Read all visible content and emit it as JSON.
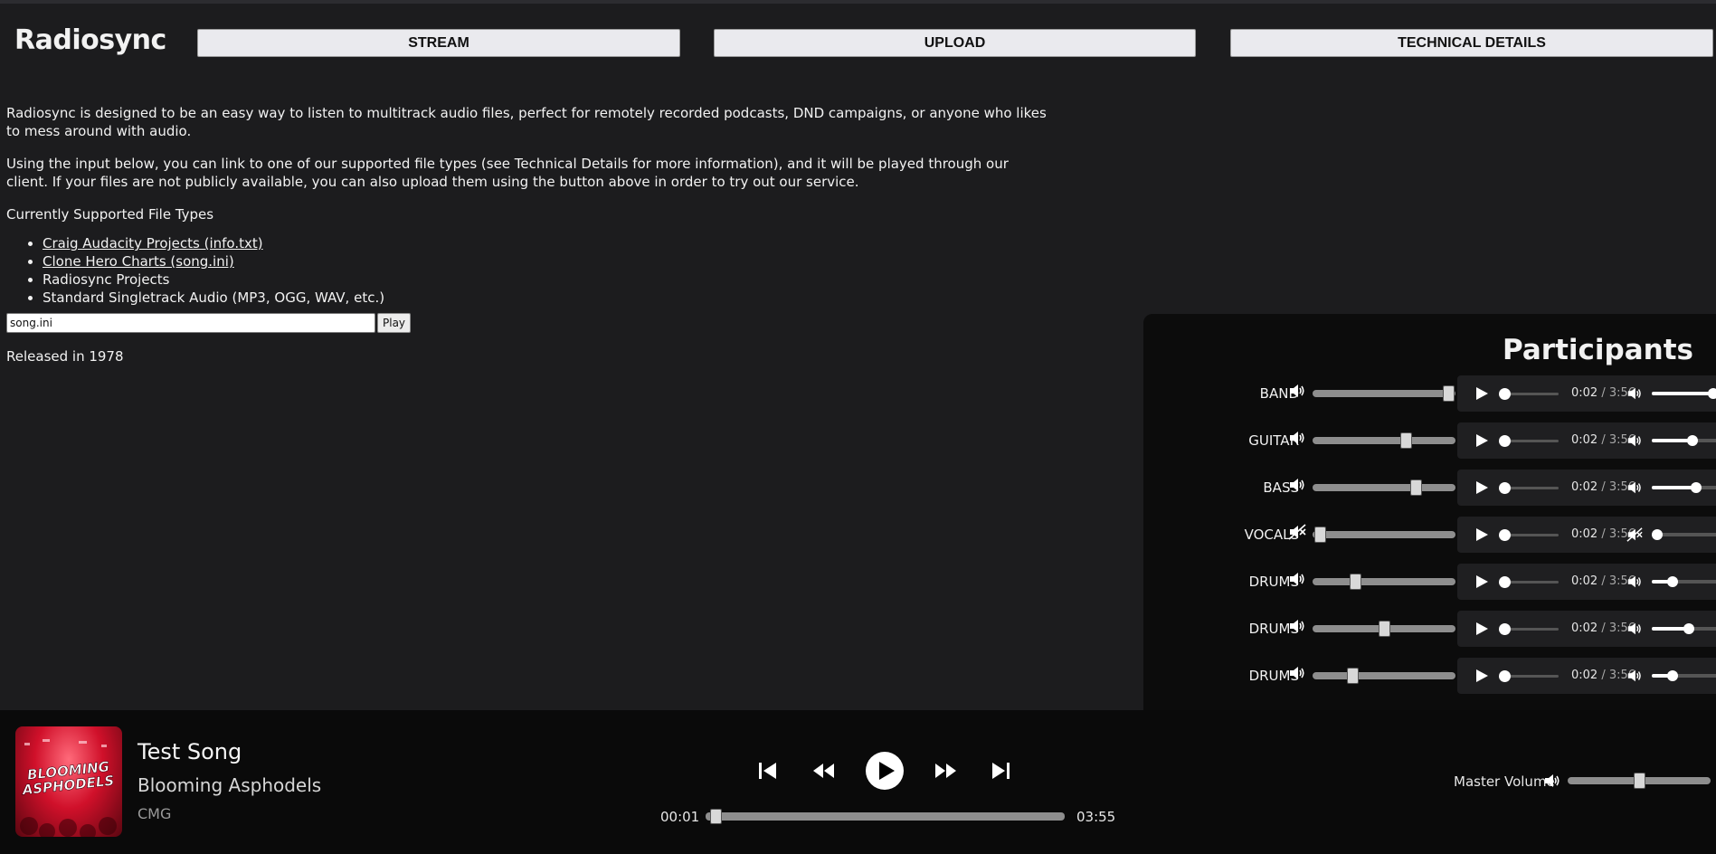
{
  "app": {
    "title": "Radiosync"
  },
  "nav": {
    "stream": "STREAM",
    "upload": "UPLOAD",
    "technical_details": "TECHNICAL DETAILS"
  },
  "intro": {
    "paragraph1": "Radiosync is designed to be an easy way to listen to multitrack audio files, perfect for remotely recorded podcasts, DND campaigns, or anyone who likes to mess around with audio.",
    "paragraph2": "Using the input below, you can link to one of our supported file types (see Technical Details for more information), and it will be played through our client. If your files are not publicly available, you can also upload them using the button above in order to try out our service.",
    "supported_heading": "Currently Supported File Types",
    "file_types": [
      {
        "label": "Craig Audacity Projects (info.txt)",
        "link": true
      },
      {
        "label": "Clone Hero Charts (song.ini)",
        "link": true
      },
      {
        "label": "Radiosync Projects",
        "link": false
      },
      {
        "label": "Standard Singletrack Audio (MP3, OGG, WAV, etc.)",
        "link": false
      }
    ]
  },
  "load": {
    "input_value": "song.ini",
    "play_label": "Play"
  },
  "released": "Released in 1978",
  "participants": {
    "title": "Participants",
    "tracks": [
      {
        "name": "BAND",
        "muted": false,
        "gain": 0.95,
        "current": "0:02",
        "duration": "/ 3:56",
        "volume": 0.9
      },
      {
        "name": "GUITAR",
        "muted": false,
        "gain": 0.65,
        "current": "0:02",
        "duration": "/ 3:56",
        "volume": 0.6
      },
      {
        "name": "BASS",
        "muted": false,
        "gain": 0.72,
        "current": "0:02",
        "duration": "/ 3:56",
        "volume": 0.65
      },
      {
        "name": "VOCALS",
        "muted": true,
        "gain": 0.05,
        "current": "0:02",
        "duration": "/ 3:56",
        "volume": 0.08
      },
      {
        "name": "DRUMS",
        "muted": false,
        "gain": 0.3,
        "current": "0:02",
        "duration": "/ 3:56",
        "volume": 0.3
      },
      {
        "name": "DRUMS",
        "muted": false,
        "gain": 0.5,
        "current": "0:02",
        "duration": "/ 3:56",
        "volume": 0.55
      },
      {
        "name": "DRUMS",
        "muted": false,
        "gain": 0.28,
        "current": "0:02",
        "duration": "/ 3:56",
        "volume": 0.3
      }
    ]
  },
  "now_playing": {
    "title": "Test Song",
    "artist": "Blooming Asphodels",
    "album": "CMG",
    "cover_text_line1": "BLOOMING",
    "cover_text_line2": "ASPHODELS",
    "current_time": "00:01",
    "total_time": "03:55",
    "progress": 0.01,
    "master_volume_label": "Master Volume",
    "master_volume": 0.5
  },
  "colors": {
    "background": "#1c1c1e",
    "panel": "#0c0c0c",
    "bar": "#0a0a0a",
    "accent": "#ffffff"
  }
}
